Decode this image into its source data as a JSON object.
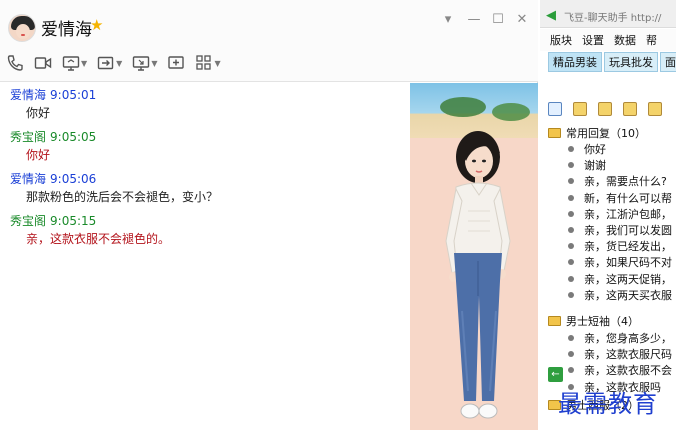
{
  "chat": {
    "contact_name": "爱情海",
    "window_controls": {
      "menu": "▾",
      "minimize": "—",
      "maximize": "☐",
      "close": "✕"
    },
    "toolbar_icons": [
      "phone-icon",
      "video-icon",
      "screen-share-icon",
      "file-transfer-icon",
      "remote-desktop-icon",
      "new-window-icon",
      "apps-grid-icon"
    ],
    "messages": [
      {
        "sender": "爱情海",
        "time": "9:05:01",
        "text": "你好",
        "side": "me"
      },
      {
        "sender": "秀宝阁",
        "time": "9:05:05",
        "text": "你好",
        "side": "other"
      },
      {
        "sender": "爱情海",
        "time": "9:05:06",
        "text": "那款粉色的洗后会不会褪色，变小？",
        "side": "me"
      },
      {
        "sender": "秀宝阁",
        "time": "9:05:15",
        "text": "亲，这款衣服不会褪色的。",
        "side": "other"
      }
    ]
  },
  "helper": {
    "title": "飞豆-聊天助手 http://",
    "menu": [
      "版块",
      "设置",
      "数据",
      "帮"
    ],
    "tabs": [
      "精品男装",
      "玩具批发",
      "面"
    ],
    "groups": [
      {
        "label": "常用回复（10）",
        "items": [
          "你好",
          "谢谢",
          "亲，需要点什么?",
          "新，有什么可以帮",
          "亲，江浙沪包邮，",
          "亲，我们可以发圆",
          "亲，货已经发出，",
          "亲，如果尺码不对",
          "亲，这两天促销，",
          "亲，这两天买衣服"
        ]
      },
      {
        "label": "男士短袖（4）",
        "items": [
          "亲，您身高多少，",
          "亲，这款衣服尺码",
          "亲，这款衣服不会",
          "亲，这款衣服吗"
        ]
      },
      {
        "label": "男士西服（2）",
        "items": []
      }
    ],
    "watermark": "最需教育"
  },
  "colors": {
    "me_name": "#1a3fd6",
    "other_name": "#1a8a2a",
    "other_text": "#b3131b",
    "tab_bg": "#d8eef8",
    "watermark": "#1f3fcf"
  }
}
